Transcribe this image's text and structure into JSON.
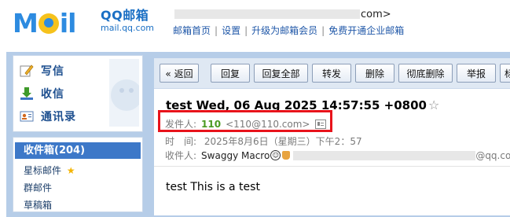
{
  "header": {
    "logo_text_left": "M",
    "logo_text_right": "il",
    "brand_name": "QQ邮箱",
    "brand_url": "mail.qq.com",
    "account_suffix": "com>",
    "links": [
      "邮箱首页",
      "设置",
      "升级为邮箱会员",
      "免费开通企业邮箱"
    ]
  },
  "quick_actions": [
    {
      "label": "写信",
      "icon": "pencil-icon"
    },
    {
      "label": "收信",
      "icon": "download-icon"
    },
    {
      "label": "通讯录",
      "icon": "contact-card-icon"
    }
  ],
  "folders": {
    "inbox": "收件箱(204)",
    "items": [
      "星标邮件",
      "群邮件",
      "草稿箱"
    ]
  },
  "toolbar": {
    "buttons": [
      "« 返回",
      "回复",
      "回复全部",
      "转发",
      "删除",
      "彻底删除",
      "举报",
      "标"
    ]
  },
  "email": {
    "subject": "test Wed, 06 Aug 2025 14:57:55 +0800",
    "star": "☆",
    "sender_label": "发件人:",
    "sender_name": "110",
    "sender_address": "<110@110.com>",
    "time_label": "时　间:",
    "time_value": "2025年8月6日（星期三）下午2：57",
    "recipient_label": "收件人:",
    "recipient_name": "Swaggy Macro",
    "recipient_suffix": "@qq.com>",
    "body": "test This is a test"
  },
  "colors": {
    "brand_blue": "#2d8be0",
    "highlight_red": "#e8131b",
    "sender_green": "#4a9a20",
    "inbox_blue": "#3d78c8"
  }
}
